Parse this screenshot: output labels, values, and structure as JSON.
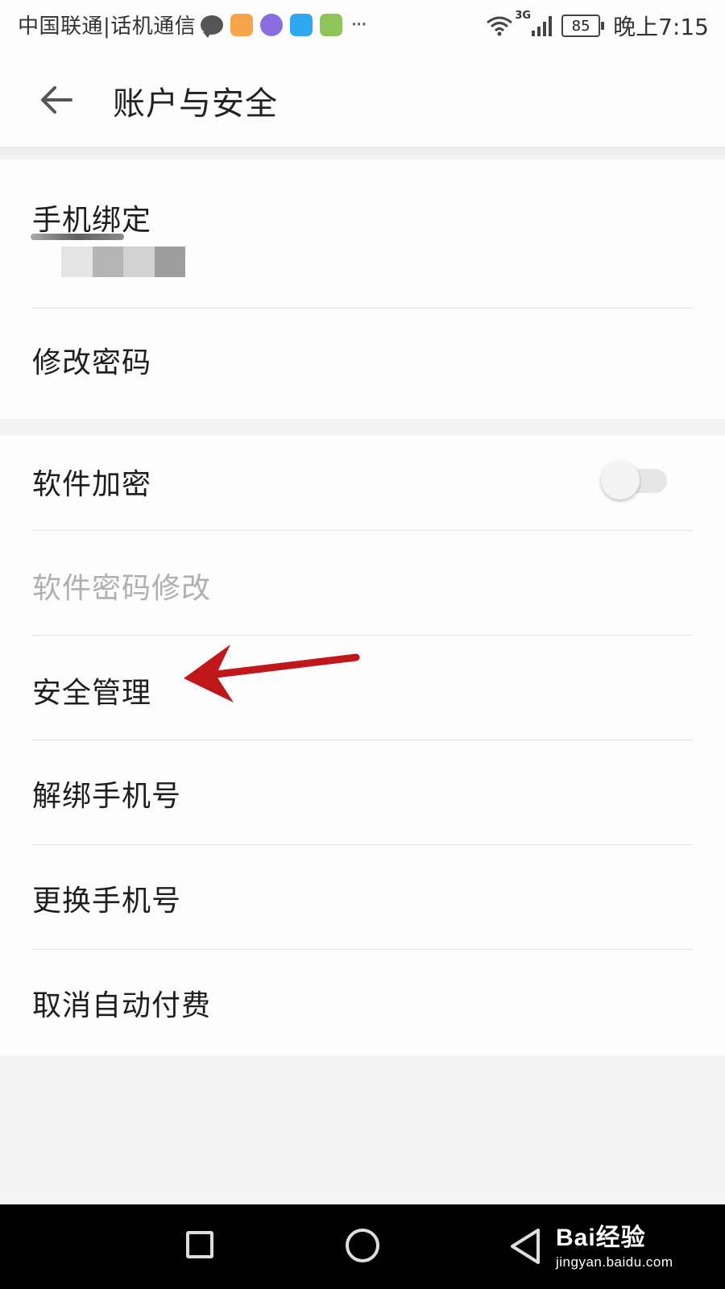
{
  "status_bar": {
    "carrier": "中国联通|话机通信",
    "battery": "85",
    "network": "3G",
    "time": "晚上7:15",
    "more": "···",
    "icons": [
      "message-icon",
      "app-icon-orange",
      "app-icon-purple",
      "app-icon-blue",
      "app-icon-green",
      "wifi-icon",
      "signal-icon",
      "battery-icon"
    ]
  },
  "header": {
    "title": "账户与安全",
    "back_icon": "back-arrow-icon"
  },
  "section_1": {
    "phone_binding": {
      "label": "手机绑定"
    },
    "change_password": {
      "label": "修改密码"
    }
  },
  "section_2": {
    "software_encryption": {
      "label": "软件加密",
      "toggle_on": false
    },
    "software_password_change": {
      "label": "软件密码修改",
      "enabled": false
    },
    "security_management": {
      "label": "安全管理"
    },
    "unbind_phone": {
      "label": "解绑手机号"
    },
    "change_phone": {
      "label": "更换手机号"
    },
    "cancel_auto_pay": {
      "label": "取消自动付费"
    }
  },
  "annotation": {
    "type": "red-arrow",
    "points_to": "安全管理",
    "color": "#c0171b"
  },
  "nav_bar": {
    "buttons": [
      "recent-apps",
      "home",
      "back"
    ],
    "watermark": {
      "brand": "Bai经验",
      "url": "jingyan.baidu.com"
    }
  },
  "colors": {
    "background": "#f4f4f4",
    "surface": "#fdfdfd",
    "text": "#1e1e1e",
    "disabled_text": "#b0b0b0",
    "divider": "#e2e2e2",
    "annotation": "#c0171b"
  }
}
